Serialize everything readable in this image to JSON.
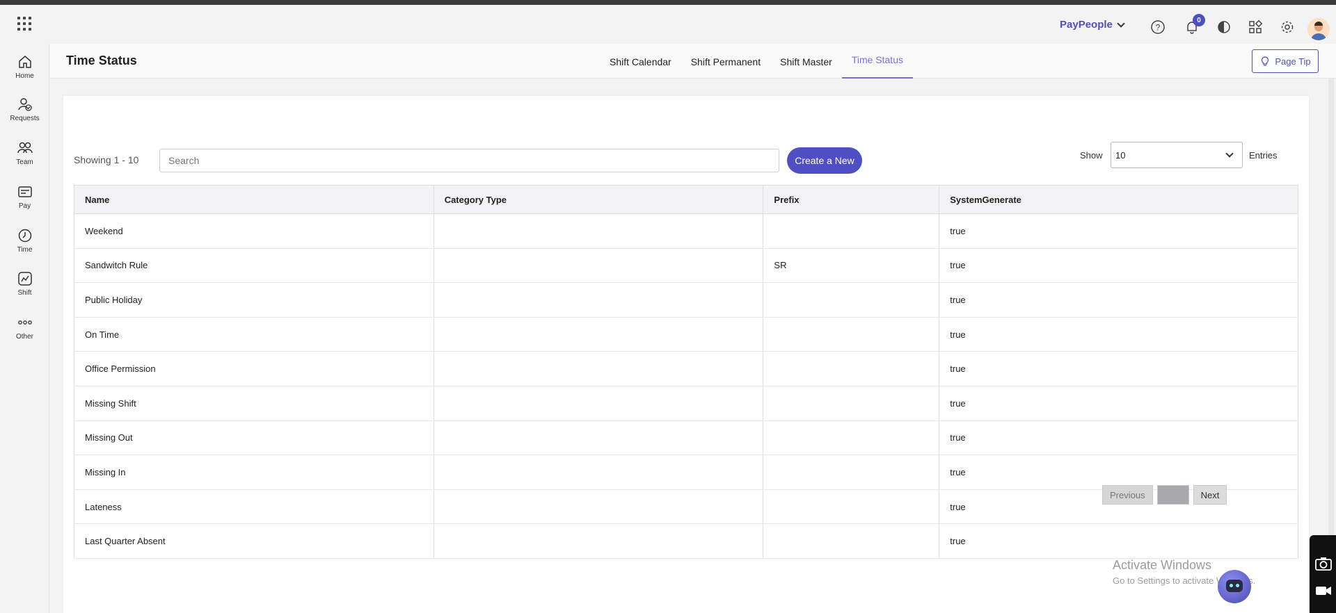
{
  "header": {
    "company": "PayPeople",
    "notification_count": "0"
  },
  "sidebar": {
    "items": [
      {
        "label": "Home",
        "icon": "home-icon"
      },
      {
        "label": "Requests",
        "icon": "user-check-icon"
      },
      {
        "label": "Team",
        "icon": "team-icon"
      },
      {
        "label": "Pay",
        "icon": "pay-card-icon"
      },
      {
        "label": "Time",
        "icon": "clock-icon"
      },
      {
        "label": "Shift",
        "icon": "chart-icon"
      },
      {
        "label": "Other",
        "icon": "dots-icon"
      }
    ]
  },
  "page": {
    "title": "Time Status",
    "tabs": [
      {
        "label": "Shift Calendar",
        "active": false
      },
      {
        "label": "Shift Permanent",
        "active": false
      },
      {
        "label": "Shift Master",
        "active": false
      },
      {
        "label": "Time Status",
        "active": true
      }
    ],
    "page_tip": "Page Tip"
  },
  "toolbar": {
    "showing": "Showing 1 - 10",
    "search_placeholder": "Search",
    "create_label": "Create a New",
    "show_label": "Show",
    "entries_value": "10",
    "entries_label": "Entries"
  },
  "table": {
    "columns": [
      "Name",
      "Category Type",
      "Prefix",
      "SystemGenerate"
    ],
    "rows": [
      {
        "name": "Weekend",
        "category": "",
        "prefix": "",
        "system": "true"
      },
      {
        "name": "Sandwitch Rule",
        "category": "",
        "prefix": "SR",
        "system": "true"
      },
      {
        "name": "Public Holiday",
        "category": "",
        "prefix": "",
        "system": "true"
      },
      {
        "name": "On Time",
        "category": "",
        "prefix": "",
        "system": "true"
      },
      {
        "name": "Office Permission",
        "category": "",
        "prefix": "",
        "system": "true"
      },
      {
        "name": "Missing Shift",
        "category": "",
        "prefix": "",
        "system": "true"
      },
      {
        "name": "Missing Out",
        "category": "",
        "prefix": "",
        "system": "true"
      },
      {
        "name": "Missing In",
        "category": "",
        "prefix": "",
        "system": "true"
      },
      {
        "name": "Lateness",
        "category": "",
        "prefix": "",
        "system": "true"
      },
      {
        "name": "Last Quarter Absent",
        "category": "",
        "prefix": "",
        "system": "true"
      }
    ]
  },
  "pagination": {
    "previous": "Previous",
    "next": "Next"
  },
  "watermark": {
    "line1": "Activate Windows",
    "line2": "Go to Settings to activate Windows."
  },
  "colors": {
    "accent": "#4f4fc4",
    "active_tab": "#7a6fd9"
  }
}
